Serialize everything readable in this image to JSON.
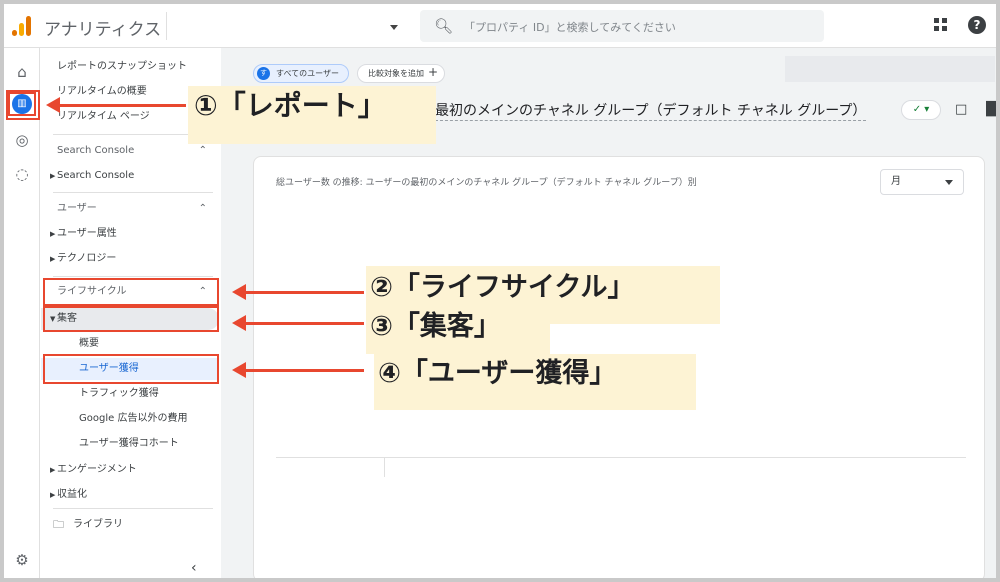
{
  "header": {
    "app_title": "アナリティクス",
    "search_placeholder": "「プロパティ ID」と検索してみてください",
    "search_icon": "search-icon",
    "apps_icon": "apps-grid-icon",
    "help_icon": "help-icon"
  },
  "rail": {
    "items": [
      {
        "name": "home-icon",
        "glyph": "⌂"
      },
      {
        "name": "reports-icon",
        "glyph": "▥"
      },
      {
        "name": "explore-icon",
        "glyph": "◎"
      },
      {
        "name": "advertising-icon",
        "glyph": "◌"
      }
    ],
    "settings_icon": "⚙"
  },
  "nav": {
    "top_items": [
      "レポートのスナップショット",
      "リアルタイムの概要",
      "リアルタイム ページ"
    ],
    "sections": [
      {
        "title": "Search Console",
        "items": [
          "Search Console"
        ]
      },
      {
        "title": "ユーザー",
        "items": [
          "ユーザー属性",
          "テクノロジー"
        ]
      },
      {
        "title": "ライフサイクル",
        "items": [
          "集客"
        ]
      }
    ],
    "acquisition_sub": [
      "概要",
      "ユーザー獲得",
      "トラフィック獲得",
      "Google 広告以外の費用",
      "ユーザー獲得コホート"
    ],
    "after_items": [
      "エンゲージメント",
      "収益化"
    ],
    "library": "ライブラリ",
    "collapse_glyph": "‹"
  },
  "main": {
    "chip_all_users": "すべてのユーザー",
    "chip_all_users_avatar": "す",
    "chip_add_compare": "比較対象を追加",
    "page_title": "最初のメインのチャネル グループ（デフォルト チャネル グループ）",
    "card_title": "総ユーザー数 の推移: ユーザーの最初のメインのチャネル グループ（デフォルト チャネル グループ）別",
    "period_value": "月"
  },
  "callouts": {
    "c1": "①「レポート」",
    "c2": "②「ライフサイクル」",
    "c3": "③「集客」",
    "c4": "④「ユーザー獲得」"
  },
  "colors": {
    "accent": "#1a73e8",
    "annotation_red": "#e8472f",
    "callout_bg": "#fdf3d4"
  }
}
